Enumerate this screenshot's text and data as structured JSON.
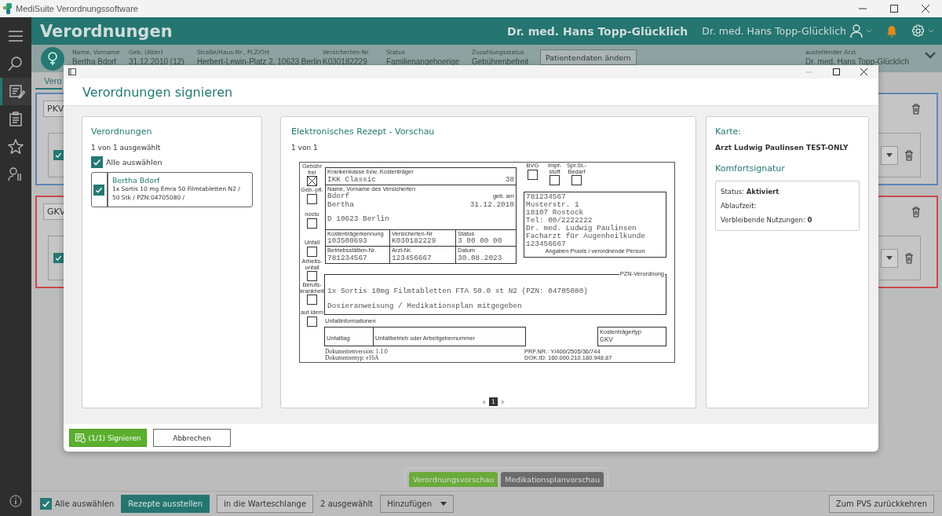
{
  "app_title": "MediSuite Verordnungssoftware",
  "sidebar_items": [
    {
      "selected": false
    },
    {
      "selected": false
    },
    {
      "selected": true
    },
    {
      "selected": false
    },
    {
      "selected": false
    },
    {
      "selected": false
    }
  ],
  "header": {
    "title": "Verordnungen",
    "doctor_title": "Dr. med. Hans Topp-Glücklich",
    "user_name": "Dr. med. Hans Topp-Glücklich"
  },
  "patient": {
    "fields": [
      {
        "label": "Name, Vorname",
        "value": "Bertha Bdorf"
      },
      {
        "label": "Geb. (Alter)",
        "value": "31.12.2010 (12)"
      },
      {
        "label": "Straße/Haus-Nr., PLZ/Ort",
        "value": "Herbert-Lewin-Platz 2, 10623 Berlin"
      },
      {
        "label": "Versicherten-Nr.",
        "value": "K030182229"
      },
      {
        "label": "Status",
        "value": "Familienangehoerige"
      },
      {
        "label": "Zuzahlungsstatus",
        "value": "Gebührenbefreit"
      }
    ],
    "edit_button": "Patientendaten ändern",
    "doctor_label": "austellender Arzt",
    "doctor": "Dr. med. Hans Topp-Glücklich"
  },
  "workspace": {
    "tab": "Vero",
    "cards": [
      {
        "label": "PKV",
        "color": "#5d87b8",
        "checked": true
      },
      {
        "label": "GKV",
        "color": "#c94b4b",
        "checked": true
      }
    ]
  },
  "preview_tabs": [
    {
      "label": "Verordnungsvorschau",
      "selected": true
    },
    {
      "label": "Medikationsplanvorschau",
      "selected": false
    }
  ],
  "bottom_bar": {
    "select_all": {
      "label": "Alle auswählen",
      "checked": true
    },
    "issue_button": "Rezepte ausstellen",
    "queue_button": "in die Warteschlange",
    "selected_count": "2 ausgewählt",
    "add_dropdown": "Hinzufügen",
    "return_button": "Zum PVS zurückkehren"
  },
  "dialog": {
    "title": "Verordnungen signieren",
    "prescriptions": {
      "title": "Verordnungen",
      "count": "1 von 1 ausgewählt",
      "select_all": {
        "label": "Alle auswählen",
        "checked": true
      },
      "items": [
        {
          "name": "Bertha Bdorf",
          "detail": "1x Sortis 10 mg Emra 50 Filmtabletten N2 / 50 Stk  / PZN:04705080 /",
          "checked": true
        }
      ]
    },
    "preview": {
      "title": "Elektronisches Rezept - Vorschau",
      "count": "1 von 1",
      "page": "1"
    },
    "card": {
      "label": "Karte:",
      "value": "Arzt Ludwig Paulinsen TEST-ONLY",
      "comfort_title": "Komfortsignatur",
      "comfort_lines": [
        "Status: **Aktiviert**",
        "Ablaufzeit:",
        "Verbleibende Nutzungen: **0**"
      ]
    },
    "buttons": [
      {
        "label": "(1/1) Signieren",
        "kind": "primary"
      },
      {
        "label": "Abbrechen",
        "kind": "secondary"
      }
    ]
  },
  "prescription_form": {
    "flags": [
      {
        "label": "Gebühr frei",
        "checked": true
      },
      {
        "label": "Geb.-pfl.",
        "checked": false
      },
      {
        "label": "noctu",
        "checked": false
      },
      {
        "label": "Unfall",
        "checked": false
      },
      {
        "label": "Arbeits-unfall",
        "checked": false
      },
      {
        "label": "Berufs-krankheit",
        "checked": false
      },
      {
        "label": "aut idem",
        "checked": false
      }
    ],
    "insurer_label": "Krankenkasse bzw. Kostenträger",
    "insurer": "IKK Classic",
    "insurer_code": "38",
    "name_label": "Name, Vorname des Versicherten",
    "last_name": "Bdorf",
    "birth_label": "geb. am",
    "first_name": "Bertha",
    "birth_date": "31.12.2010",
    "city": "D 10623 Berlin",
    "id_rows": [
      [
        {
          "label": "Kostenträgerkennung",
          "value": "103500693"
        },
        {
          "label": "Versicherten-Nr",
          "value": "K030182229"
        },
        {
          "label": "Status",
          "value": "3 00 00 00"
        }
      ],
      [
        {
          "label": "Betriebsstätten-Nr.",
          "value": "781234567"
        },
        {
          "label": "Arzt-Nr.",
          "value": "123456667"
        },
        {
          "label": "Datum",
          "value": "30.08.2023"
        }
      ]
    ],
    "extra_flags": [
      {
        "label": "BVG",
        "checked": false
      },
      {
        "label": "Impf-stoff",
        "checked": false
      },
      {
        "label": "Spr.St.-Bedarf",
        "checked": false
      }
    ],
    "practice_lines": [
      "781234567",
      "Musterstr. 1",
      "18107 Rostock",
      "Tel: 00/2222222",
      "Dr. med. Ludwig Paulinsen",
      "Facharzt für Augenheilkunde",
      "123456667"
    ],
    "practice_label": "Angaben Praxis / verordnende Person",
    "pzn_label": "PZN-Verordnung",
    "pzn_lines": [
      "1x Sortis 10mg Filmtabletten FTA 50.0 st N2 (PZN: 04705080)",
      "Dosieranweisung / Medikationsplan mitgegeben"
    ],
    "accident_label": "Unfallinformationen",
    "accident_fields": [
      "Unfalltag",
      "Unfallbetrieb oder Arbeitgebernummer"
    ],
    "cost_type_label": "Kostenträgertyp",
    "cost_type": "GKV",
    "footer_left": [
      "Dokumentenversion: 1.1.0",
      "Dokumententyp: e16A"
    ],
    "footer_right": [
      "PRF.NR.: Y/400/2505/36/744",
      "DOK.ID: 160.000.210.180.948.87"
    ]
  }
}
